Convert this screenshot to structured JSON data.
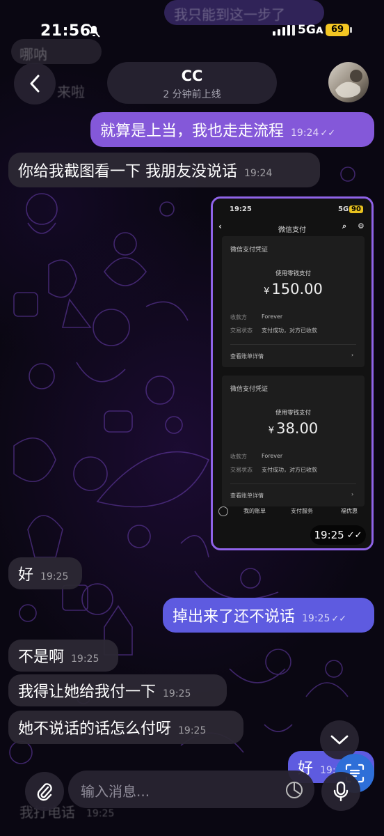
{
  "status_bar": {
    "time": "21:56",
    "network": "5Gᴀ",
    "battery": "69"
  },
  "header": {
    "name": "CC",
    "status": "2 分钟前上线"
  },
  "ghosts": {
    "top_out": "我只能到这一步了",
    "top_in": "哪呐",
    "under_header": "来啦",
    "bottom_in": "我打电话",
    "bottom_in_time": "19:25"
  },
  "messages": [
    {
      "dir": "out",
      "text": "就算是上当，我也走走流程",
      "time": "19:24",
      "read": "✓✓"
    },
    {
      "dir": "in",
      "text": "你给我截图看一下 我朋友没说话",
      "time": "19:24"
    },
    {
      "dir": "in",
      "text": "好",
      "time": "19:25"
    },
    {
      "dir": "out",
      "text": "掉出来了还不说话",
      "time": "19:25",
      "read": "✓✓"
    },
    {
      "dir": "in",
      "text": "不是啊",
      "time": "19:25"
    },
    {
      "dir": "in",
      "text": "我得让她给我付一下",
      "time": "19:25"
    },
    {
      "dir": "in",
      "text": "她不说话的话怎么付呀",
      "time": "19:25"
    },
    {
      "dir": "out",
      "text": "好",
      "time": "19:25"
    }
  ],
  "image_message": {
    "time": "19:25",
    "read": "✓✓",
    "screenshot": {
      "status_time": "19:25",
      "network": "5G",
      "battery": "90",
      "title": "微信支付",
      "cards": [
        {
          "title": "微信支付凭证",
          "subtitle": "使用零钱支付",
          "currency": "¥",
          "amount": "150.00",
          "payee_label": "收款方",
          "payee": "Forever",
          "status_label": "交易状态",
          "status": "支付成功，对方已收款",
          "detail": "查看账单详情"
        },
        {
          "title": "微信支付凭证",
          "subtitle": "使用零钱支付",
          "currency": "¥",
          "amount": "38.00",
          "payee_label": "收款方",
          "payee": "Forever",
          "status_label": "交易状态",
          "status": "支付成功，对方已收款",
          "detail": "查看账单详情"
        }
      ],
      "bottom_tabs": [
        "我的账单",
        "支付服务",
        "福优惠"
      ]
    }
  },
  "input": {
    "placeholder": "输入消息..."
  },
  "colors": {
    "outgoing_purple": "#8458d9",
    "outgoing_blue": "#5e5be0",
    "incoming": "#2c2834",
    "image_border": "#8f63e8"
  }
}
